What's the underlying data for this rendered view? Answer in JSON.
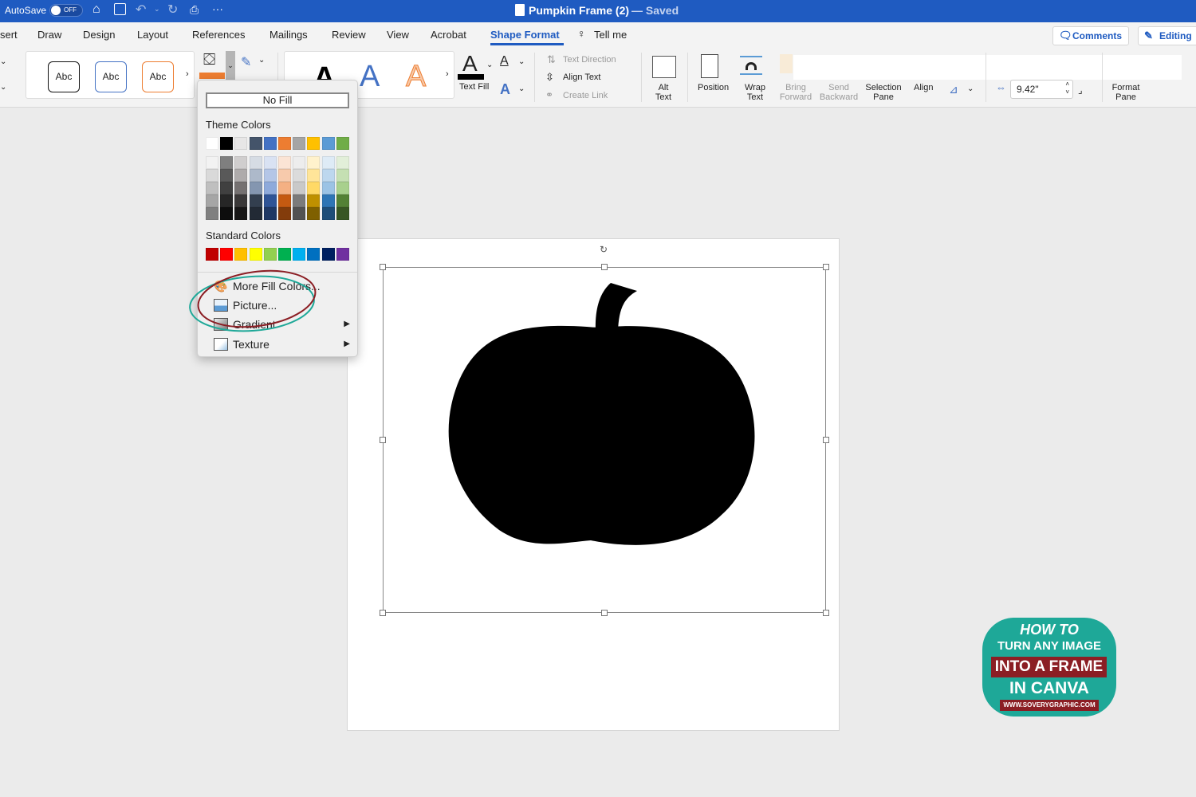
{
  "titlebar": {
    "autosave_label": "AutoSave",
    "autosave_state": "OFF",
    "doc_title": "Pumpkin Frame (2)",
    "saved_status": "— Saved",
    "color": "#1f5bc1"
  },
  "tabs": [
    {
      "label": "sert"
    },
    {
      "label": "Draw"
    },
    {
      "label": "Design"
    },
    {
      "label": "Layout"
    },
    {
      "label": "References"
    },
    {
      "label": "Mailings"
    },
    {
      "label": "Review"
    },
    {
      "label": "View"
    },
    {
      "label": "Acrobat"
    },
    {
      "label": "Shape Format",
      "active": true
    },
    {
      "label": "Tell me"
    }
  ],
  "header_buttons": {
    "comments": "Comments",
    "editing": "Editing"
  },
  "ribbon": {
    "style_sample": "Abc",
    "wordart_sample": "A",
    "text_fill": "Text Fill",
    "text_direction": "Text Direction",
    "align_text": "Align Text",
    "create_link": "Create Link",
    "alt_text": "Alt Text",
    "position": "Position",
    "wrap_text": "Wrap Text",
    "bring_forward": "Bring Forward",
    "send_backward": "Send Backward",
    "selection_pane": "Selection Pane",
    "align": "Align",
    "width_value": "9.42\"",
    "format_pane": "Format Pane",
    "shape_fill_color": "#ed7d31"
  },
  "fill_menu": {
    "no_fill": "No Fill",
    "theme_colors_label": "Theme Colors",
    "theme_colors": [
      "#ffffff",
      "#000000",
      "#e7e6e6",
      "#44546a",
      "#4472c4",
      "#ed7d31",
      "#a5a5a5",
      "#ffc000",
      "#5b9bd5",
      "#70ad47"
    ],
    "theme_shades": [
      [
        "#f2f2f2",
        "#d9d9d9",
        "#bfbfbf",
        "#a6a6a6",
        "#808080"
      ],
      [
        "#7f7f7f",
        "#595959",
        "#404040",
        "#262626",
        "#0d0d0d"
      ],
      [
        "#d0cece",
        "#aeabab",
        "#757171",
        "#3a3838",
        "#171616"
      ],
      [
        "#d6dce4",
        "#adb9ca",
        "#8496b0",
        "#333f4f",
        "#222a35"
      ],
      [
        "#d9e2f3",
        "#b4c6e7",
        "#8eaadb",
        "#2f5496",
        "#1f3864"
      ],
      [
        "#fbe4d5",
        "#f7caac",
        "#f4b083",
        "#c55a11",
        "#833c0b"
      ],
      [
        "#ededed",
        "#dbdbdb",
        "#c9c9c9",
        "#7b7b7b",
        "#525252"
      ],
      [
        "#fff2cc",
        "#ffe599",
        "#ffd966",
        "#bf9000",
        "#7f6000"
      ],
      [
        "#deebf6",
        "#bdd7ee",
        "#9cc3e5",
        "#2e75b5",
        "#1e4e79"
      ],
      [
        "#e2efd9",
        "#c5e0b3",
        "#a8d08d",
        "#538135",
        "#375623"
      ]
    ],
    "standard_colors_label": "Standard Colors",
    "standard_colors": [
      "#c00000",
      "#ff0000",
      "#ffc000",
      "#ffff00",
      "#92d050",
      "#00b050",
      "#00b0f0",
      "#0070c0",
      "#002060",
      "#7030a0"
    ],
    "items": [
      {
        "label": "More Fill Colors...",
        "icon": "palette-icon"
      },
      {
        "label": "Picture...",
        "icon": "picture-icon"
      },
      {
        "label": "Gradient",
        "icon": "gradient-icon",
        "submenu": true
      },
      {
        "label": "Texture",
        "icon": "texture-icon",
        "submenu": true
      }
    ]
  },
  "badge": {
    "line1": "HOW TO",
    "line2": "TURN ANY IMAGE",
    "line3": "INTO A FRAME",
    "line4": "IN CANVA",
    "url": "WWW.SOVERYGRAPHIC.COM",
    "bg": "#1ea898",
    "accent": "#8b1e24"
  }
}
